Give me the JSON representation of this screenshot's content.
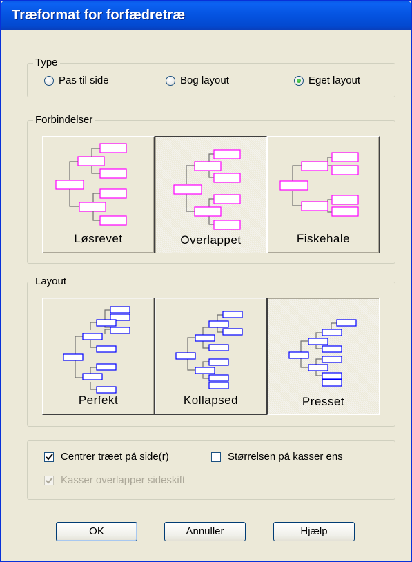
{
  "window": {
    "title": "Træformat for forfædretræ"
  },
  "type_group": {
    "title": "Type",
    "options": [
      {
        "label": "Pas til side",
        "selected": false
      },
      {
        "label": "Bog layout",
        "selected": false
      },
      {
        "label": "Eget layout",
        "selected": true
      }
    ]
  },
  "connections_group": {
    "title": "Forbindelser",
    "buttons": [
      {
        "label": "Løsrevet",
        "selected": false,
        "icon": "detached-tree-icon"
      },
      {
        "label": "Overlappet",
        "selected": true,
        "icon": "overlapped-tree-icon"
      },
      {
        "label": "Fiskehale",
        "selected": false,
        "icon": "fishtail-tree-icon"
      }
    ],
    "icon_color": "#ff00ff"
  },
  "layout_group": {
    "title": "Layout",
    "buttons": [
      {
        "label": "Perfekt",
        "selected": false,
        "icon": "perfect-layout-icon"
      },
      {
        "label": "Kollapsed",
        "selected": false,
        "icon": "collapsed-layout-icon"
      },
      {
        "label": "Presset",
        "selected": true,
        "icon": "pressed-layout-icon"
      }
    ],
    "icon_color": "#0000ff"
  },
  "options_group": {
    "center_tree": {
      "label": "Centrer træet på side(r)",
      "checked": true,
      "enabled": true
    },
    "equal_box_size": {
      "label": "Størrelsen på kasser ens",
      "checked": false,
      "enabled": true
    },
    "boxes_overlap_page_breaks": {
      "label": "Kasser overlapper sideskift",
      "checked": true,
      "enabled": false
    }
  },
  "buttons": {
    "ok": "OK",
    "cancel": "Annuller",
    "help": "Hjælp"
  }
}
